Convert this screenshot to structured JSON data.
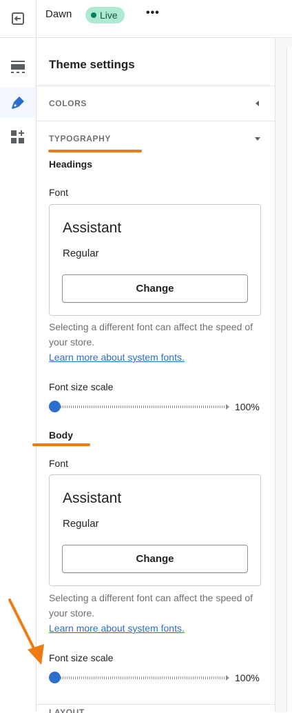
{
  "topbar": {
    "store_name": "Dawn",
    "live_label": "Live",
    "more_label": "•••"
  },
  "rail": {
    "icons": [
      "exit-icon",
      "sections-icon",
      "theme-brush-icon",
      "add-apps-icon"
    ],
    "active": "theme-brush-icon"
  },
  "panel": {
    "title": "Theme settings",
    "colors_label": "COLORS",
    "typography_label": "TYPOGRAPHY",
    "next_section_label": "LAYOUT"
  },
  "headings": {
    "title": "Headings",
    "font_label": "Font",
    "font_name": "Assistant",
    "font_style": "Regular",
    "change_label": "Change",
    "help_text": "Selecting a different font can affect the speed of your store.",
    "help_link": "Learn more about system fonts.",
    "scale_label": "Font size scale",
    "scale_value": "100%",
    "scale_fraction": 0
  },
  "body": {
    "title": "Body",
    "font_label": "Font",
    "font_name": "Assistant",
    "font_style": "Regular",
    "change_label": "Change",
    "help_text": "Selecting a different font can affect the speed of your store.",
    "help_link": "Learn more about system fonts.",
    "scale_label": "Font size scale",
    "scale_value": "100%",
    "scale_fraction": 0
  },
  "colors": {
    "accent": "#2c6ecb",
    "live_badge": "#aee9d1",
    "annotation": "#f07b12"
  }
}
